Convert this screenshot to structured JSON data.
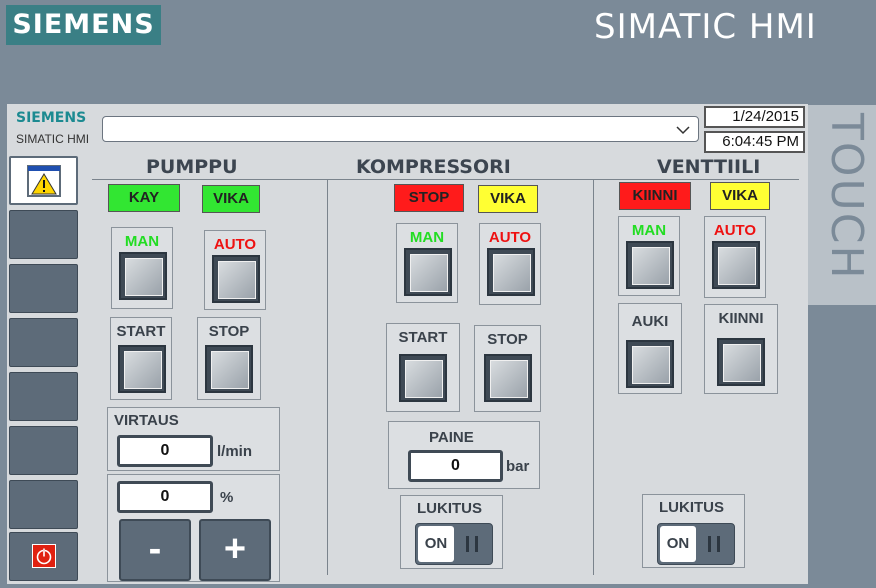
{
  "header": {
    "brand": "SIEMENS",
    "product": "SIMATIC HMI",
    "side_label": "TOUCH"
  },
  "screen_header": {
    "brand": "SIEMENS",
    "product": "SIMATIC HMI",
    "date": "1/24/2015",
    "time": "6:04:45 PM"
  },
  "nav": {
    "icons": [
      "alarm-warning-icon",
      "power-icon"
    ]
  },
  "pumppu": {
    "title": "PUMPPU",
    "indicator_run": "KAY",
    "indicator_fault": "VIKA",
    "man": "MAN",
    "auto": "AUTO",
    "start": "START",
    "stop": "STOP",
    "flow_label": "VIRTAUS",
    "flow_value": "0",
    "flow_unit": "l/min",
    "percent_value": "0",
    "percent_unit": "%",
    "minus": "-",
    "plus": "+"
  },
  "kompressori": {
    "title": "KOMPRESSORI",
    "indicator_state": "STOP",
    "indicator_fault": "VIKA",
    "man": "MAN",
    "auto": "AUTO",
    "start": "START",
    "stop": "STOP",
    "pressure_label": "PAINE",
    "pressure_value": "0",
    "pressure_unit": "bar",
    "lock_label": "LUKITUS",
    "lock_state": "ON"
  },
  "venttiili": {
    "title": "VENTTIILI",
    "indicator_state": "KIINNI",
    "indicator_fault": "VIKA",
    "man": "MAN",
    "auto": "AUTO",
    "open": "AUKI",
    "close": "KIINNI",
    "lock_label": "LUKITUS",
    "lock_state": "ON"
  },
  "colors": {
    "green": "#32e632",
    "red": "#ff1b1b",
    "yellow": "#ffff33",
    "brand": "#3a7f85"
  }
}
